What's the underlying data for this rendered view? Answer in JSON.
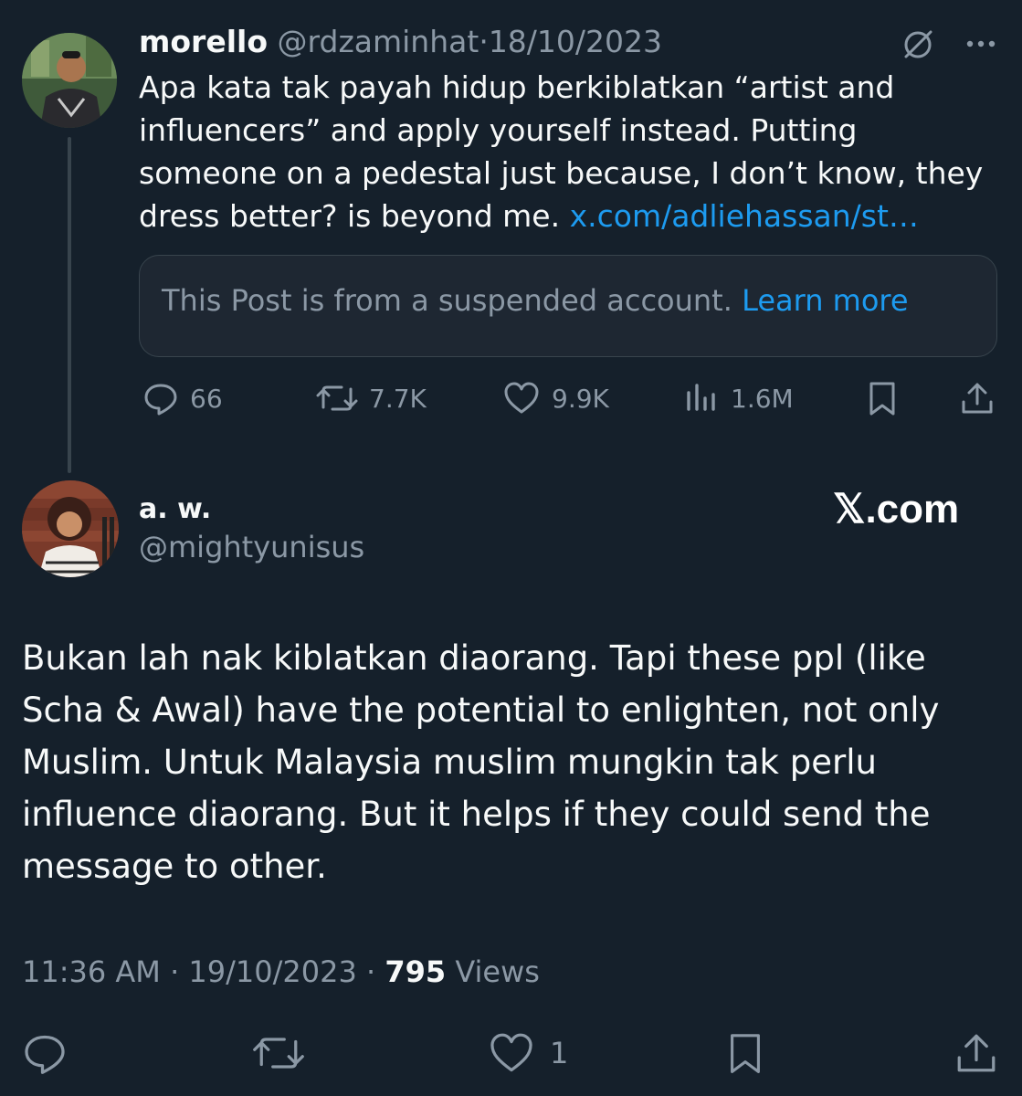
{
  "post1": {
    "name": "morello",
    "handle": "@rdzaminhat",
    "separator": "·",
    "date": "18/10/2023",
    "text": "Apa kata tak payah hidup berkiblatkan “artist and influencers” and apply yourself instead. Putting someone on a pedestal just because, I don’t know, they dress better? is beyond me.",
    "link": "x.com/adliehassan/st…",
    "quote_text": "This Post is from a suspended account.",
    "quote_link": "Learn more",
    "replies": "66",
    "reposts": "7.7K",
    "likes": "9.9K",
    "views": "1.6M"
  },
  "post2": {
    "name": "a. w.",
    "handle": "@mightyunisus",
    "watermark": "𝕏.com",
    "text": "Bukan lah nak kiblatkan diaorang. Tapi these ppl (like Scha & Awal) have the potential to enlighten, not only Muslim. Untuk Malaysia muslim mungkin tak perlu influence diaorang. But it helps if they could send the message to other.",
    "time": "11:36 AM",
    "separator": "·",
    "date": "19/10/2023",
    "views_count": "795",
    "views_label": "Views",
    "likes": "1"
  },
  "icons": [
    "grok-icon",
    "more-icon",
    "reply-icon",
    "repost-icon",
    "like-icon",
    "views-icon",
    "bookmark-icon",
    "share-icon"
  ],
  "colors": {
    "background": "#15202b",
    "accent": "#1d9bf0",
    "muted": "#8b98a5",
    "border": "#38444d"
  }
}
